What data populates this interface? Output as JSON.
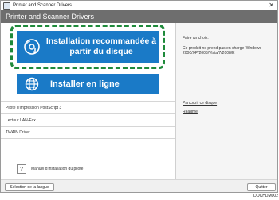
{
  "window": {
    "title": "Printer and Scanner Drivers",
    "header": "Printer and Scanner Drivers",
    "close_glyph": "✕"
  },
  "main": {
    "recommended_install": "Installation recommandée à partir du disque",
    "online_install": "Installer en ligne"
  },
  "list": {
    "items": [
      "Pilote d'impression PostScript 3",
      "Lecteur LAN-Fax",
      "TWAIN Driver"
    ]
  },
  "manual": {
    "icon": "?",
    "label": "Manuel d'installation du pilote"
  },
  "right": {
    "line1": "Faire un choix.",
    "note": "Ce produit ne prend pas en charge Windows 2000/XP/2003/Vista/7/2008/E",
    "link_browse": "Parcourir ce disque",
    "link_readme": "Readme"
  },
  "bottom": {
    "language_button": "Sélection de la langue",
    "quit_button": "Quitter"
  },
  "figure_code": "DOCHDM002",
  "colors": {
    "primary_button": "#1a7ac7",
    "highlight_dash": "#1f8a3b",
    "header": "#6e6e6e"
  }
}
